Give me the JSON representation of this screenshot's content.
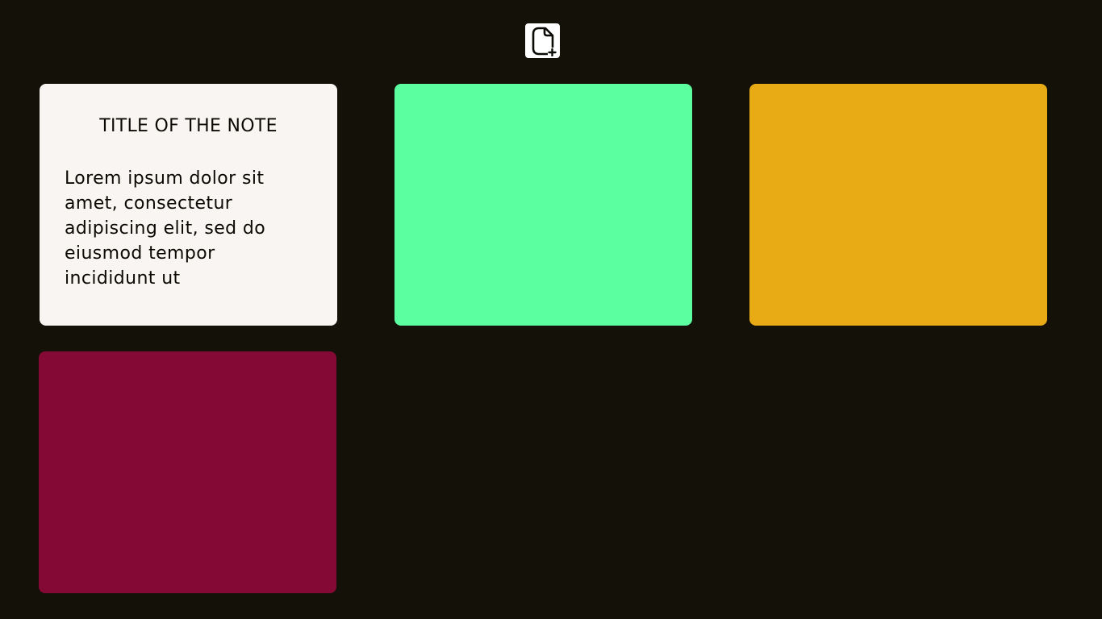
{
  "toolbar": {
    "new_note_icon": "file-plus-icon"
  },
  "notes": [
    {
      "title": "TITLE OF THE NOTE",
      "body": "Lorem ipsum dolor sit amet, consectetur adipiscing elit, sed do eiusmod tempor incididunt ut",
      "color": "#f9f5f2"
    },
    {
      "title": "",
      "body": "",
      "color": "#5cff9f"
    },
    {
      "title": "",
      "body": "",
      "color": "#e8ab16"
    },
    {
      "title": "",
      "body": "",
      "color": "#840934"
    }
  ],
  "colors": {
    "background": "#131108",
    "text": "#0c0a05"
  }
}
